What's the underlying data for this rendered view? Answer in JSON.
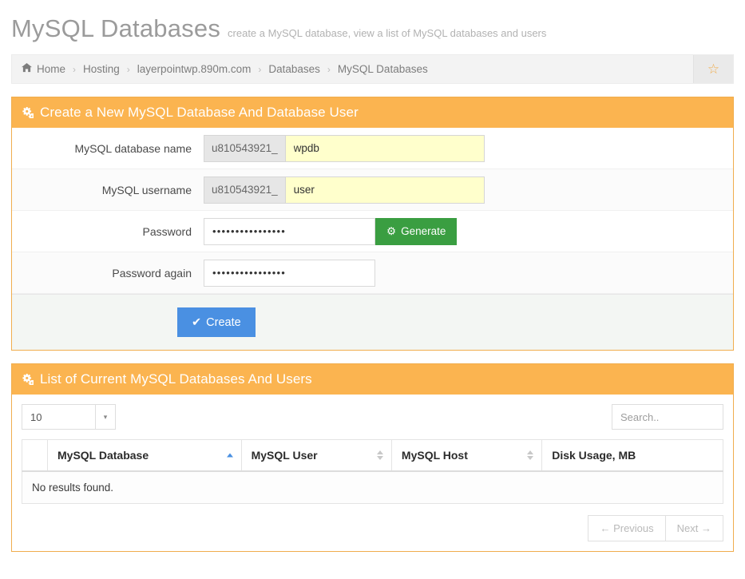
{
  "header": {
    "title": "MySQL Databases",
    "subtitle": "create a MySQL database, view a list of MySQL databases and users"
  },
  "breadcrumb": {
    "home_icon": "home-icon",
    "separator": "›",
    "items": [
      {
        "label": "Home"
      },
      {
        "label": "Hosting"
      },
      {
        "label": "layerpointwp.890m.com"
      },
      {
        "label": "Databases"
      },
      {
        "label": "MySQL Databases"
      }
    ],
    "favorite_icon": "☆"
  },
  "create_panel": {
    "icon": "cogs-icon",
    "title": "Create a New MySQL Database And Database User",
    "fields": {
      "db_name": {
        "label": "MySQL database name",
        "prefix": "u810543921_",
        "value": "wpdb",
        "placeholder": ""
      },
      "username": {
        "label": "MySQL username",
        "prefix": "u810543921_",
        "value": "user",
        "placeholder": ""
      },
      "password": {
        "label": "Password",
        "value": "••••••••••••••••",
        "placeholder": ""
      },
      "password_again": {
        "label": "Password again",
        "value": "••••••••••••••••",
        "placeholder": ""
      }
    },
    "generate_button": {
      "label": "Generate",
      "icon": "⚙",
      "color": "#3a9e41"
    },
    "create_button": {
      "label": "Create",
      "icon": "✔",
      "color": "#4a90e2"
    }
  },
  "list_panel": {
    "icon": "cogs-icon",
    "title": "List of Current MySQL Databases And Users",
    "page_length": {
      "value": "10",
      "caret": "▾"
    },
    "search": {
      "placeholder": "Search..",
      "value": ""
    },
    "table": {
      "columns": [
        {
          "label": "MySQL Database",
          "sort": "asc"
        },
        {
          "label": "MySQL User",
          "sort": "none"
        },
        {
          "label": "MySQL Host",
          "sort": "none"
        },
        {
          "label": "Disk Usage, MB",
          "sort": "off"
        }
      ],
      "rows": [],
      "empty_message": "No results found."
    },
    "pagination": {
      "previous": "← Previous",
      "next": "Next →"
    }
  },
  "colors": {
    "panel_accent": "#fbb450",
    "panel_border": "#f0ad4e",
    "primary": "#4a90e2",
    "success": "#3a9e41",
    "highlight": "#ffffcc",
    "star": "#f0ad4e"
  }
}
